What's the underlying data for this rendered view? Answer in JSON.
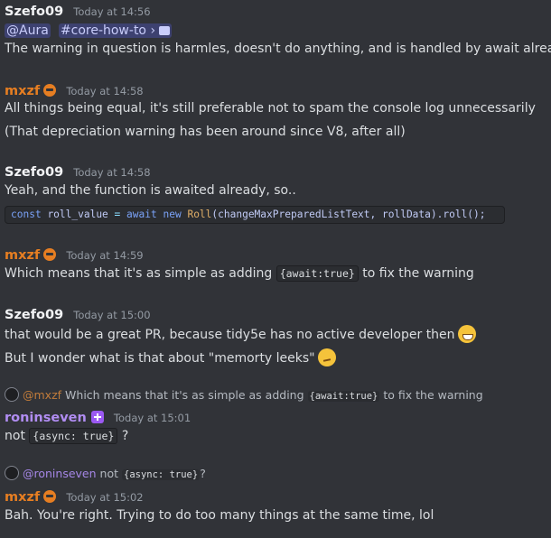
{
  "messages": [
    {
      "user": "Szefo09",
      "time": "Today at 14:56",
      "mention": "@Aura",
      "channel": "#core-how-to",
      "channel_arrow": "›",
      "line1": "The warning in question is harmles, doesn't do anything, and is handled by await already."
    },
    {
      "user": "mxzf",
      "time": "Today at 14:58",
      "line1": "All things being equal, it's still preferable not to spam the console log unnecessarily",
      "line2": "(That depreciation warning has been around since V8, after all)"
    },
    {
      "user": "Szefo09",
      "time": "Today at 14:58",
      "line1": "Yeah, and the function is awaited already, so..",
      "code": {
        "kw1": "const",
        "var": "roll_value",
        "eq": "=",
        "kw2": "await",
        "kw3": "new",
        "cls": "Roll",
        "args": "(changeMaxPreparedListText, rollData)",
        "tail": ".roll();"
      }
    },
    {
      "user": "mxzf",
      "time": "Today at 14:59",
      "pre": "Which means that it's as simple as adding",
      "code": "{await:true}",
      "post": "to fix the warning"
    },
    {
      "user": "Szefo09",
      "time": "Today at 15:00",
      "line1": "that would be a great PR, because tidy5e has no active developer then",
      "line2": "But I wonder what is that about \"memorty leeks\""
    },
    {
      "reply_name": "@mxzf",
      "reply_pre": "Which means that it's as simple as adding",
      "reply_code": "{await:true}",
      "reply_post": "to fix the warning",
      "user": "roninseven",
      "time": "Today at 15:01",
      "pre": "not",
      "code": "{async: true}",
      "post": "?"
    },
    {
      "reply_name": "@roninseven",
      "reply_pre": "not",
      "reply_code": "{async: true}",
      "reply_post": "?",
      "user": "mxzf",
      "time": "Today at 15:02",
      "line1": "Bah.  You're right.  Trying to do too many things at the same time, lol"
    }
  ],
  "colors": {
    "background": "#313338",
    "mxzf": "#e67e22",
    "roninseven": "#b18df2",
    "text": "#dbdee1"
  },
  "icons": [
    "badge-icon",
    "grinning-emoji",
    "thinking-emoji",
    "channel-chat-icon"
  ]
}
